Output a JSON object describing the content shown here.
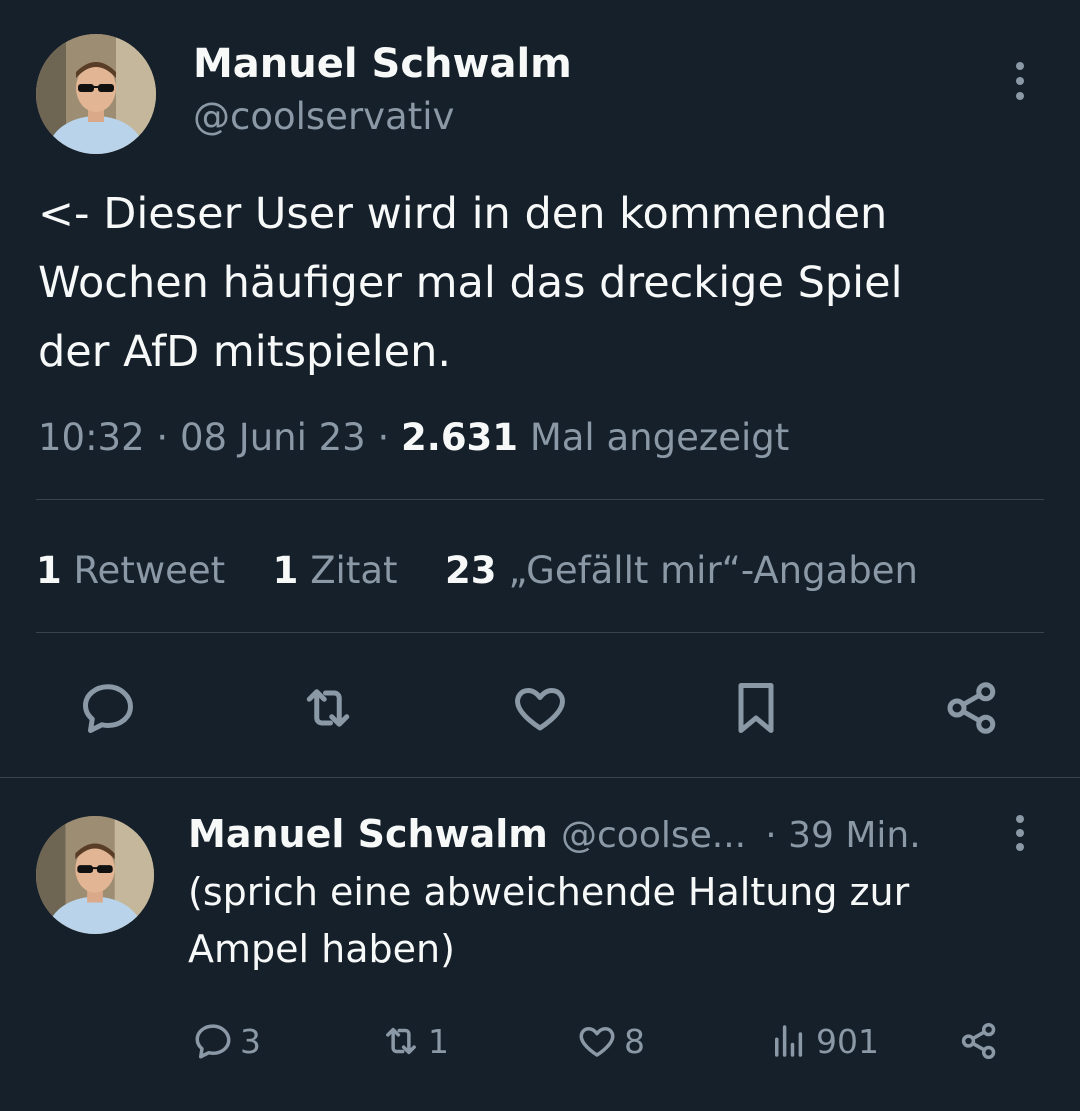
{
  "main_tweet": {
    "author_name": "Manuel Schwalm",
    "author_handle": "@coolservativ",
    "text": "<- Dieser User wird in den kommenden\nWochen häufiger mal das dreckige Spiel\nder AfD mitspielen.",
    "time": "10:32",
    "date": "08 Juni 23",
    "separator": "·",
    "views_count": "2.631",
    "views_label": "Mal angezeigt",
    "stats": {
      "retweets_count": "1",
      "retweets_label": "Retweet",
      "quotes_count": "1",
      "quotes_label": "Zitat",
      "likes_count": "23",
      "likes_label": "„Gefällt mir“-Angaben"
    },
    "actions": [
      "reply-icon",
      "retweet-icon",
      "like-icon",
      "bookmark-icon",
      "share-icon"
    ]
  },
  "reply_tweet": {
    "author_name": "Manuel Schwalm",
    "author_handle": "@coolse...",
    "time_ago": "· 39 Min.",
    "text": "(sprich eine abweichende Haltung zur\nAmpel haben)",
    "reply_count": "3",
    "retweet_count": "1",
    "like_count": "8",
    "views_count": "901"
  },
  "colors": {
    "background": "#15202b",
    "text_primary": "#f7f9f9",
    "text_secondary": "#8b98a5",
    "divider": "#38444d"
  }
}
